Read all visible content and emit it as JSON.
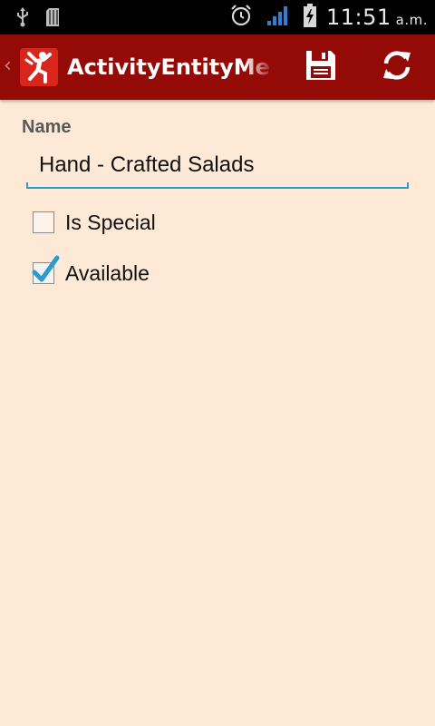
{
  "status_bar": {
    "time": "11:51",
    "ampm": "a.m.",
    "icons": [
      "usb-icon",
      "sd-card-icon",
      "alarm-icon",
      "signal-icon",
      "battery-charging-icon"
    ]
  },
  "action_bar": {
    "title": "ActivityEntityMenu",
    "background": "#940a06",
    "actions": [
      {
        "name": "save",
        "icon": "floppy-disk-icon"
      },
      {
        "name": "refresh",
        "icon": "refresh-icon"
      }
    ]
  },
  "form": {
    "name_label": "Name",
    "name_value": "Hand - Crafted Salads",
    "is_special_label": "Is Special",
    "is_special_checked": false,
    "available_label": "Available",
    "available_checked": true,
    "accent": "#2a9bd1"
  },
  "colors": {
    "page_background": "#fde9d5",
    "action_bar": "#940a06",
    "accent": "#2a9bd1"
  }
}
